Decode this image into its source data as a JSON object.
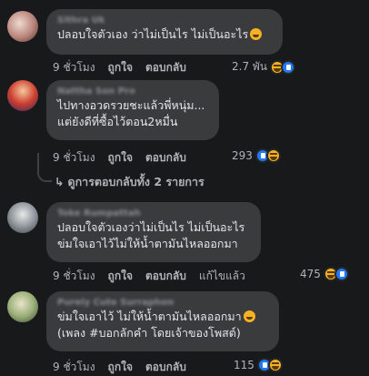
{
  "colors": {
    "background": "#18191a",
    "bubble": "#3a3b3c",
    "text": "#e4e6eb",
    "muted": "#b0b3b8",
    "like": "#2078f4",
    "haha": "#f7b125"
  },
  "comments": [
    {
      "author": "Sithra Uk",
      "lines": [
        "ปลอบใจตัวเอง ว่าไม่เป็นไร ไม่เป็นอะไร"
      ],
      "inline_emoji": "grin-sweat-icon",
      "time": "9 ชั่วโมง",
      "like_label": "ถูกใจ",
      "reply_label": "ตอบกลับ",
      "reaction_count": "2.7 พัน",
      "reactions": [
        "haha",
        "like"
      ]
    },
    {
      "author": "Nattha Son Pro",
      "lines": [
        "ไปทางอวดรวยชะแล้วพี่หนุ่ม...",
        "แต่ยังดีที่ซื้อไว้ตอน2หมื่น"
      ],
      "time": "9 ชั่วโมง",
      "like_label": "ถูกใจ",
      "reply_label": "ตอบกลับ",
      "reaction_count": "293",
      "reactions": [
        "like",
        "haha"
      ]
    },
    {
      "author": "Toke Rumpattah",
      "lines": [
        "ปลอบใจตัวเองว่าไม่เป็นไร ไม่เป็นอะไร",
        "ข่มใจเอาไว้ไม่ให้น้ำตามันไหลออกมา"
      ],
      "time": "9 ชั่วโมง",
      "like_label": "ถูกใจ",
      "reply_label": "ตอบกลับ",
      "edited_label": "แก้ไขแล้ว",
      "reaction_count": "475",
      "reactions": [
        "haha",
        "like"
      ]
    },
    {
      "author": "Purely Cute Surraphon",
      "lines": [
        "ข่มใจเอาไว้ ไม่ให้น้ำตามันไหลออกมา",
        "(เพลง #บอกลักคำ โดยเจ้าของโพสต์)"
      ],
      "inline_emoji": "rofl-icon",
      "time": "9 ชั่วโมง",
      "like_label": "ถูกใจ",
      "reply_label": "ตอบกลับ",
      "reaction_count": "115",
      "reactions": [
        "like",
        "haha"
      ]
    }
  ],
  "view_replies": "ดูการตอบกลับทั้ง 2 รายการ"
}
